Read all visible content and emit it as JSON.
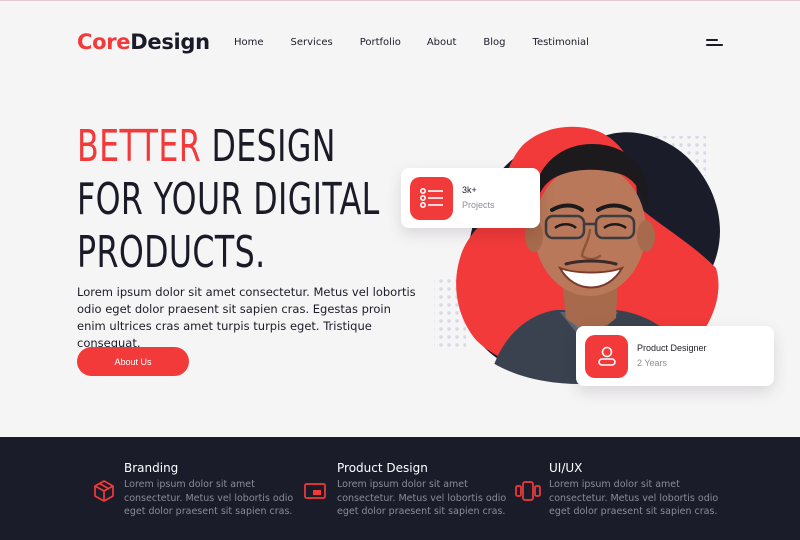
{
  "brand": {
    "part1": "Core",
    "part2": "Design"
  },
  "nav": {
    "items": [
      "Home",
      "Services",
      "Portfolio",
      "About",
      "Blog",
      "Testimonial"
    ]
  },
  "hero": {
    "headline_red": "BETTER",
    "headline_line1_rest": " DESIGN",
    "headline_line2": "FOR YOUR DIGITAL",
    "headline_line3": "PRODUCTS.",
    "description": "Lorem ipsum dolor sit amet consectetur. Metus vel lobortis odio eget dolor praesent sit sapien cras. Egestas proin enim ultrices cras amet turpis turpis eget. Tristique consequat.",
    "cta_label": "About Us"
  },
  "stats_card": {
    "value": "3k+",
    "label": "Projects",
    "icon": "list-icon"
  },
  "role_card": {
    "title": "Product Designer",
    "subtitle": "2 Years",
    "icon": "user-icon"
  },
  "services": [
    {
      "title": "Branding",
      "body": "Lorem ipsum dolor sit amet consectetur. Metus vel lobortis odio eget dolor praesent sit sapien cras.",
      "icon": "box-icon"
    },
    {
      "title": "Product Design",
      "body": "Lorem ipsum dolor sit amet consectetur. Metus vel lobortis odio eget dolor praesent sit sapien cras.",
      "icon": "screen-icon"
    },
    {
      "title": "UI/UX",
      "body": "Lorem ipsum dolor sit amet consectetur. Metus vel lobortis odio eget dolor praesent sit sapien cras.",
      "icon": "devices-icon"
    }
  ],
  "colors": {
    "accent": "#f23a3a",
    "dark": "#1b1c2a",
    "background": "#f6f5f6"
  }
}
